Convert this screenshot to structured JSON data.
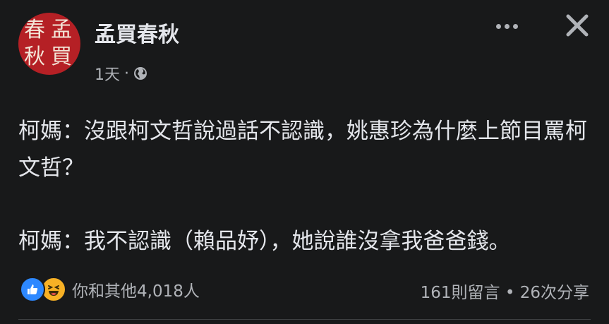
{
  "page": {
    "avatar_chars": [
      "春",
      "孟",
      "秋",
      "買"
    ],
    "name": "孟買春秋",
    "time": "1天",
    "separator": "·"
  },
  "post": {
    "paragraph1": "柯媽：沒跟柯文哲說過話不認識，姚惠珍為什麼上節目罵柯文哲？",
    "paragraph2": "柯媽：我不認識（賴品妤），她說誰沒拿我爸爸錢。"
  },
  "footer": {
    "reactions_text": "你和其他4,018人",
    "comments": "161則留言",
    "dot": "•",
    "shares": "26次分享"
  },
  "icons": {
    "more": "more-horizontal-icon",
    "close": "close-icon",
    "privacy": "globe-icon",
    "reaction1": "like-icon",
    "reaction2": "haha-icon"
  },
  "colors": {
    "background": "#18191a",
    "primary_text": "#e4e6eb",
    "secondary_text": "#b0b3b8",
    "avatar": "#b52025",
    "like": "#2d88ff",
    "haha": "#f7b125"
  }
}
